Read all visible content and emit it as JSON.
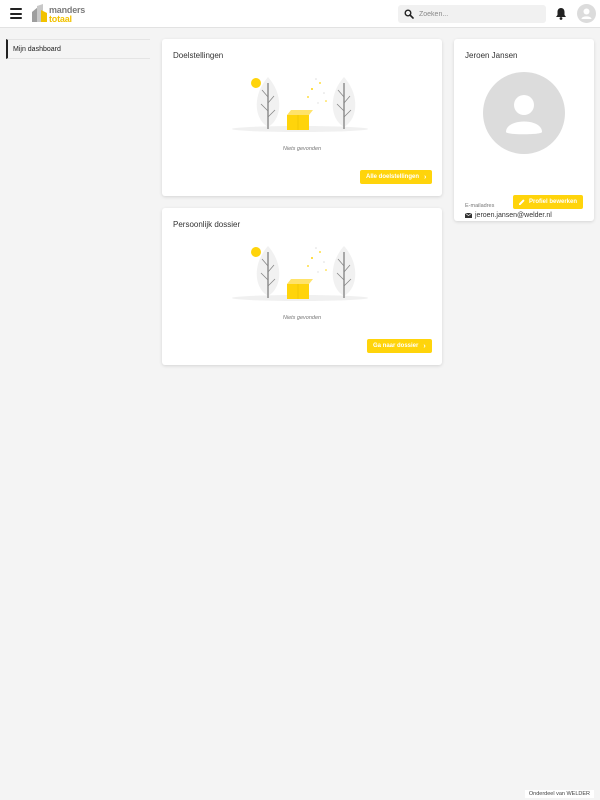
{
  "header": {
    "logo_line1": "manders",
    "logo_line2": "totaal",
    "search_placeholder": "Zoeken...",
    "icons": [
      "menu-icon",
      "search-icon",
      "bell-icon",
      "user-avatar-icon"
    ]
  },
  "sidebar": {
    "items": [
      {
        "label": "Mijn dashboard",
        "active": true
      }
    ]
  },
  "cards": {
    "goals": {
      "title": "Doelstellingen",
      "empty_text": "Niets gevonden",
      "button_label": "Alle doelstellingen"
    },
    "dossier": {
      "title": "Persoonlijk dossier",
      "empty_text": "Niets gevonden",
      "button_label": "Ga naar dossier"
    }
  },
  "profile": {
    "name": "Jeroen Jansen",
    "email_label": "E-mailadres",
    "email": "jeroen.jansen@welder.nl",
    "edit_button_label": "Profiel bewerken"
  },
  "footer": {
    "text": "Onderdeel van WELDER"
  },
  "colors": {
    "accent": "#ffd40b",
    "background": "#f4f4f4",
    "logo_gray": "#7b7b7b",
    "logo_yellow": "#f2c200"
  }
}
